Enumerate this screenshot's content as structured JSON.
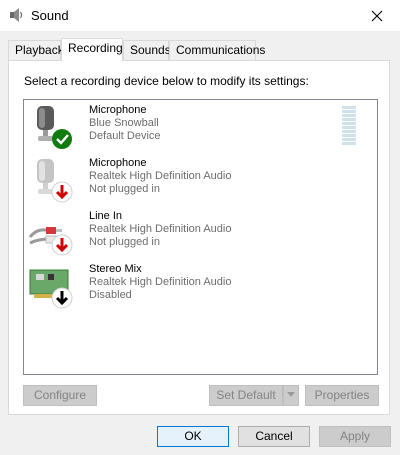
{
  "window": {
    "title": "Sound"
  },
  "tabs": [
    {
      "label": "Playback"
    },
    {
      "label": "Recording"
    },
    {
      "label": "Sounds"
    },
    {
      "label": "Communications"
    }
  ],
  "instruction": "Select a recording device below to modify its settings:",
  "devices": [
    {
      "name": "Microphone",
      "driver": "Blue Snowball",
      "status": "Default Device",
      "icon": "microphone-icon",
      "badge": "default-check"
    },
    {
      "name": "Microphone",
      "driver": "Realtek High Definition Audio",
      "status": "Not plugged in",
      "icon": "microphone-icon",
      "badge": "unplugged-red"
    },
    {
      "name": "Line In",
      "driver": "Realtek High Definition Audio",
      "status": "Not plugged in",
      "icon": "line-in-cable-icon",
      "badge": "unplugged-red"
    },
    {
      "name": "Stereo Mix",
      "driver": "Realtek High Definition Audio",
      "status": "Disabled",
      "icon": "sound-card-icon",
      "badge": "disabled-black"
    }
  ],
  "buttons": {
    "configure": "Configure",
    "set_default": "Set Default",
    "properties": "Properties",
    "ok": "OK",
    "cancel": "Cancel",
    "apply": "Apply"
  },
  "colors": {
    "accent": "#0078d7",
    "check_green": "#107c10",
    "unplugged_red": "#d40000"
  }
}
